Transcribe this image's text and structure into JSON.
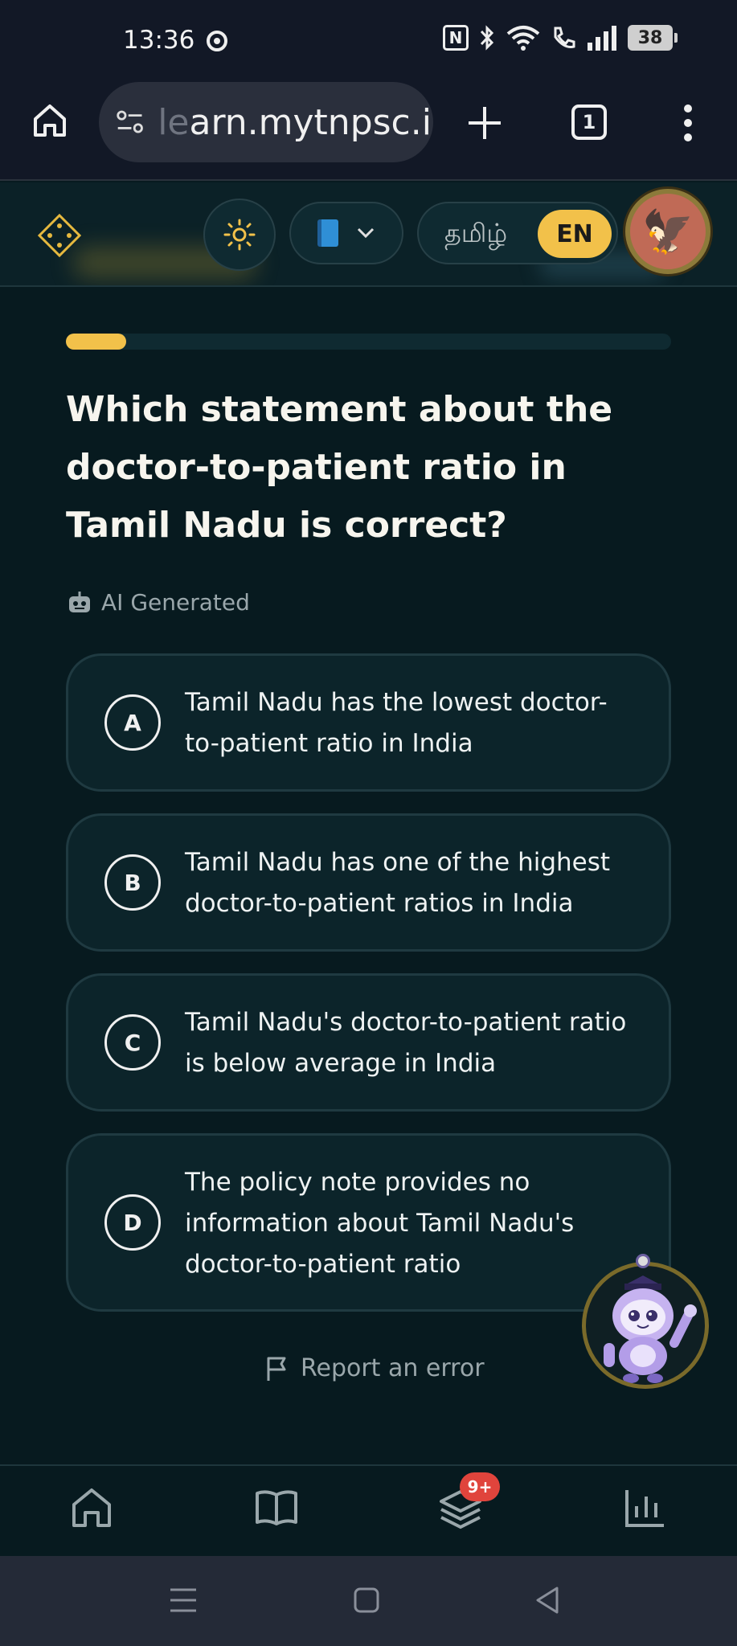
{
  "status_bar": {
    "time": "13:36",
    "nfc_label": "N",
    "battery": "38"
  },
  "browser": {
    "url_fade": "le",
    "url": "arn.mytnpsc.in",
    "tab_count": "1"
  },
  "header": {
    "lang_tamil": "தமிழ்",
    "lang_en": "EN",
    "avatar_emoji": "🦅"
  },
  "quiz": {
    "progress": 0.1,
    "question": "Which statement about the doctor-to-patient ratio in Tamil Nadu is correct?",
    "ai_badge": "AI Generated",
    "options": [
      {
        "letter": "A",
        "text": "Tamil Nadu has the lowest doctor-to-patient ratio in India"
      },
      {
        "letter": "B",
        "text": "Tamil Nadu has one of the highest doctor-to-patient ratios in India"
      },
      {
        "letter": "C",
        "text": "Tamil Nadu's doctor-to-patient ratio is below average in India"
      },
      {
        "letter": "D",
        "text": "The policy note provides no information about Tamil Nadu's doctor-to-patient ratio"
      }
    ],
    "report_label": "Report an error"
  },
  "bottom_nav": {
    "badge": "9+"
  },
  "colors": {
    "background": "#071a1f",
    "accent": "#f2c14a",
    "card": "#0c242a",
    "badge": "#e0443c"
  }
}
